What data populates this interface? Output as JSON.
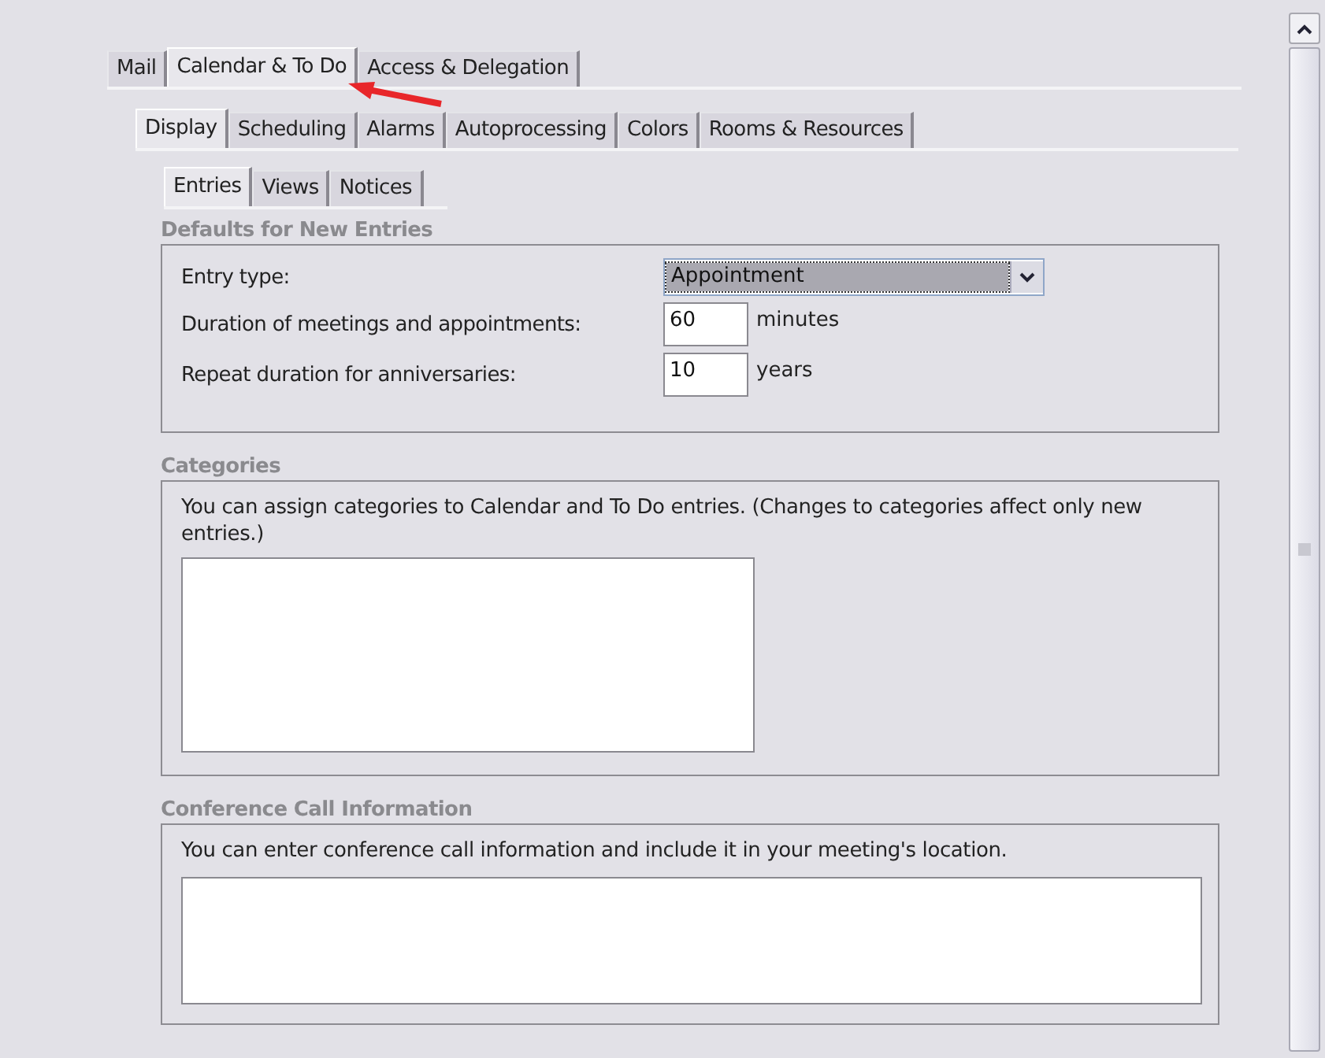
{
  "tabs": [
    {
      "label": "Mail",
      "selected": false
    },
    {
      "label": "Calendar & To Do",
      "selected": true
    },
    {
      "label": "Access & Delegation",
      "selected": false
    }
  ],
  "subtabs": [
    {
      "label": "Display",
      "selected": true
    },
    {
      "label": "Scheduling",
      "selected": false
    },
    {
      "label": "Alarms",
      "selected": false
    },
    {
      "label": "Autoprocessing",
      "selected": false
    },
    {
      "label": "Colors",
      "selected": false
    },
    {
      "label": "Rooms & Resources",
      "selected": false
    }
  ],
  "inner_tabs": [
    {
      "label": "Entries",
      "selected": true
    },
    {
      "label": "Views",
      "selected": false
    },
    {
      "label": "Notices",
      "selected": false
    }
  ],
  "defaults": {
    "title": "Defaults for New Entries",
    "entry_type": {
      "label": "Entry type:",
      "value": "Appointment"
    },
    "fields": [
      {
        "label": "Duration of meetings and appointments:",
        "value": "60",
        "unit": "minutes"
      },
      {
        "label": "Repeat duration for anniversaries:",
        "value": "10",
        "unit": "years"
      }
    ]
  },
  "categories": {
    "title": "Categories",
    "text": "You can assign categories to Calendar and To Do entries.  (Changes to categories affect only new entries.)"
  },
  "conference": {
    "title": "Conference Call Information",
    "text": "You can enter conference call information and include it in your meeting's location."
  }
}
